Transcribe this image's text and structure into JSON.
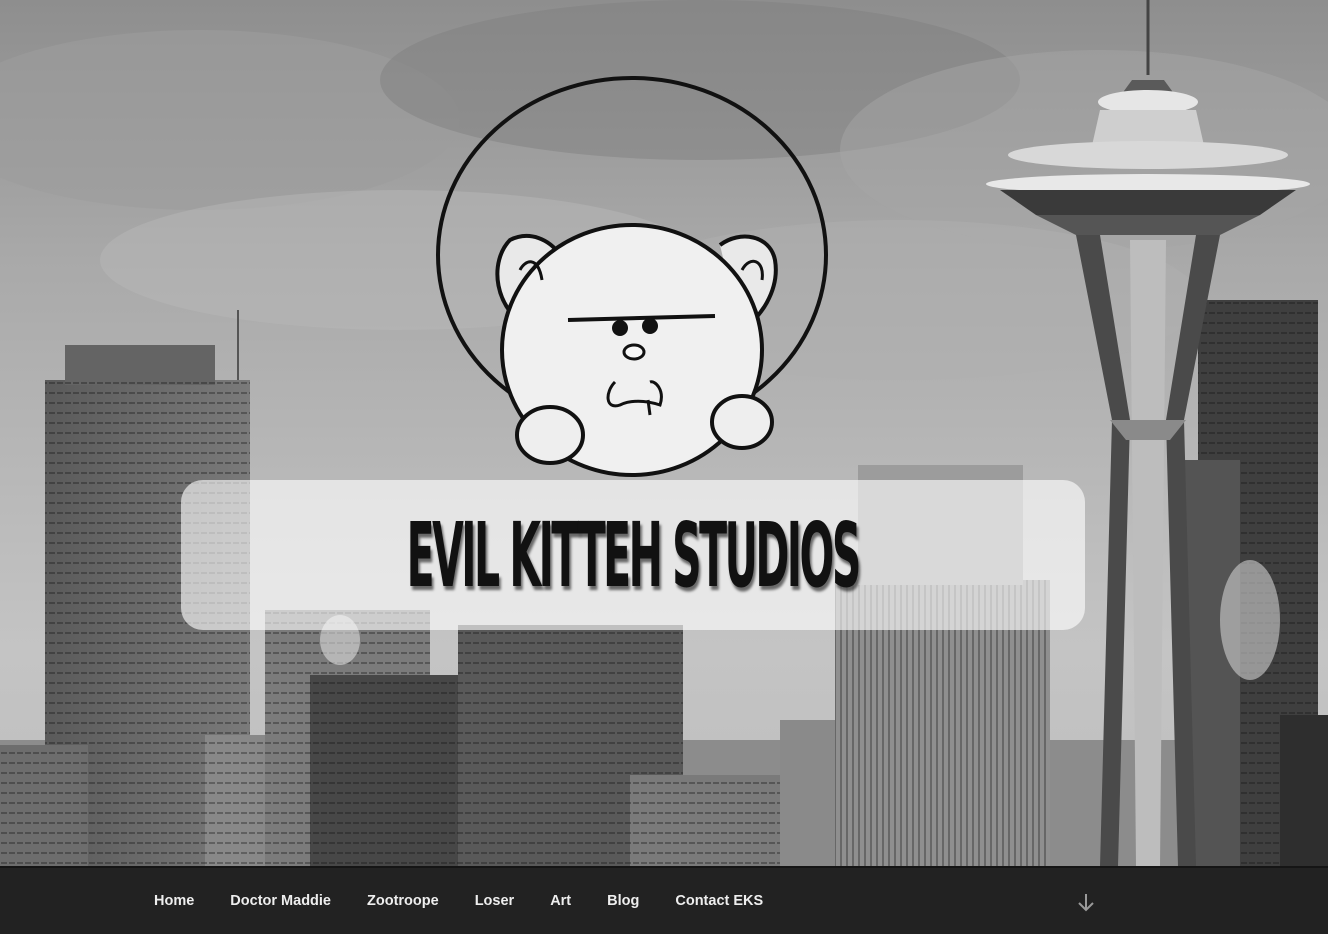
{
  "header": {
    "site_title": "Evil Kitteh Studios",
    "logo_icon": "evil-kitten-face-in-circle",
    "background_image": "seattle-skyline-space-needle-grayscale"
  },
  "navigation": {
    "items": [
      {
        "label": "Home"
      },
      {
        "label": "Doctor Maddie"
      },
      {
        "label": "Zootroope"
      },
      {
        "label": "Loser"
      },
      {
        "label": "Art"
      },
      {
        "label": "Blog"
      },
      {
        "label": "Contact EKS"
      }
    ],
    "scroll_icon": "arrow-down-icon"
  },
  "colors": {
    "nav_background": "#222222",
    "nav_text": "#eeeeee",
    "panel": "rgba(255,255,255,0.62)"
  }
}
